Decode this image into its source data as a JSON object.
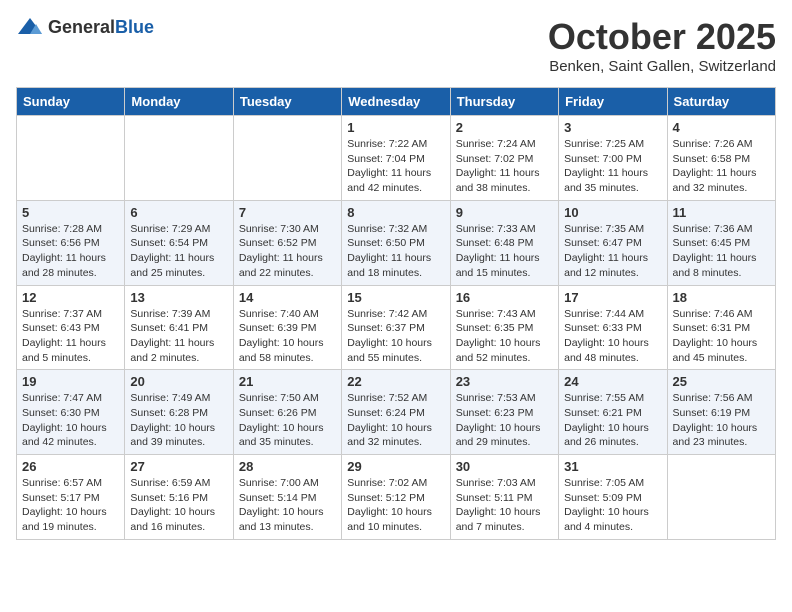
{
  "header": {
    "logo_general": "General",
    "logo_blue": "Blue",
    "month": "October 2025",
    "location": "Benken, Saint Gallen, Switzerland"
  },
  "days_of_week": [
    "Sunday",
    "Monday",
    "Tuesday",
    "Wednesday",
    "Thursday",
    "Friday",
    "Saturday"
  ],
  "weeks": [
    [
      {
        "day": "",
        "info": ""
      },
      {
        "day": "",
        "info": ""
      },
      {
        "day": "",
        "info": ""
      },
      {
        "day": "1",
        "info": "Sunrise: 7:22 AM\nSunset: 7:04 PM\nDaylight: 11 hours and 42 minutes."
      },
      {
        "day": "2",
        "info": "Sunrise: 7:24 AM\nSunset: 7:02 PM\nDaylight: 11 hours and 38 minutes."
      },
      {
        "day": "3",
        "info": "Sunrise: 7:25 AM\nSunset: 7:00 PM\nDaylight: 11 hours and 35 minutes."
      },
      {
        "day": "4",
        "info": "Sunrise: 7:26 AM\nSunset: 6:58 PM\nDaylight: 11 hours and 32 minutes."
      }
    ],
    [
      {
        "day": "5",
        "info": "Sunrise: 7:28 AM\nSunset: 6:56 PM\nDaylight: 11 hours and 28 minutes."
      },
      {
        "day": "6",
        "info": "Sunrise: 7:29 AM\nSunset: 6:54 PM\nDaylight: 11 hours and 25 minutes."
      },
      {
        "day": "7",
        "info": "Sunrise: 7:30 AM\nSunset: 6:52 PM\nDaylight: 11 hours and 22 minutes."
      },
      {
        "day": "8",
        "info": "Sunrise: 7:32 AM\nSunset: 6:50 PM\nDaylight: 11 hours and 18 minutes."
      },
      {
        "day": "9",
        "info": "Sunrise: 7:33 AM\nSunset: 6:48 PM\nDaylight: 11 hours and 15 minutes."
      },
      {
        "day": "10",
        "info": "Sunrise: 7:35 AM\nSunset: 6:47 PM\nDaylight: 11 hours and 12 minutes."
      },
      {
        "day": "11",
        "info": "Sunrise: 7:36 AM\nSunset: 6:45 PM\nDaylight: 11 hours and 8 minutes."
      }
    ],
    [
      {
        "day": "12",
        "info": "Sunrise: 7:37 AM\nSunset: 6:43 PM\nDaylight: 11 hours and 5 minutes."
      },
      {
        "day": "13",
        "info": "Sunrise: 7:39 AM\nSunset: 6:41 PM\nDaylight: 11 hours and 2 minutes."
      },
      {
        "day": "14",
        "info": "Sunrise: 7:40 AM\nSunset: 6:39 PM\nDaylight: 10 hours and 58 minutes."
      },
      {
        "day": "15",
        "info": "Sunrise: 7:42 AM\nSunset: 6:37 PM\nDaylight: 10 hours and 55 minutes."
      },
      {
        "day": "16",
        "info": "Sunrise: 7:43 AM\nSunset: 6:35 PM\nDaylight: 10 hours and 52 minutes."
      },
      {
        "day": "17",
        "info": "Sunrise: 7:44 AM\nSunset: 6:33 PM\nDaylight: 10 hours and 48 minutes."
      },
      {
        "day": "18",
        "info": "Sunrise: 7:46 AM\nSunset: 6:31 PM\nDaylight: 10 hours and 45 minutes."
      }
    ],
    [
      {
        "day": "19",
        "info": "Sunrise: 7:47 AM\nSunset: 6:30 PM\nDaylight: 10 hours and 42 minutes."
      },
      {
        "day": "20",
        "info": "Sunrise: 7:49 AM\nSunset: 6:28 PM\nDaylight: 10 hours and 39 minutes."
      },
      {
        "day": "21",
        "info": "Sunrise: 7:50 AM\nSunset: 6:26 PM\nDaylight: 10 hours and 35 minutes."
      },
      {
        "day": "22",
        "info": "Sunrise: 7:52 AM\nSunset: 6:24 PM\nDaylight: 10 hours and 32 minutes."
      },
      {
        "day": "23",
        "info": "Sunrise: 7:53 AM\nSunset: 6:23 PM\nDaylight: 10 hours and 29 minutes."
      },
      {
        "day": "24",
        "info": "Sunrise: 7:55 AM\nSunset: 6:21 PM\nDaylight: 10 hours and 26 minutes."
      },
      {
        "day": "25",
        "info": "Sunrise: 7:56 AM\nSunset: 6:19 PM\nDaylight: 10 hours and 23 minutes."
      }
    ],
    [
      {
        "day": "26",
        "info": "Sunrise: 6:57 AM\nSunset: 5:17 PM\nDaylight: 10 hours and 19 minutes."
      },
      {
        "day": "27",
        "info": "Sunrise: 6:59 AM\nSunset: 5:16 PM\nDaylight: 10 hours and 16 minutes."
      },
      {
        "day": "28",
        "info": "Sunrise: 7:00 AM\nSunset: 5:14 PM\nDaylight: 10 hours and 13 minutes."
      },
      {
        "day": "29",
        "info": "Sunrise: 7:02 AM\nSunset: 5:12 PM\nDaylight: 10 hours and 10 minutes."
      },
      {
        "day": "30",
        "info": "Sunrise: 7:03 AM\nSunset: 5:11 PM\nDaylight: 10 hours and 7 minutes."
      },
      {
        "day": "31",
        "info": "Sunrise: 7:05 AM\nSunset: 5:09 PM\nDaylight: 10 hours and 4 minutes."
      },
      {
        "day": "",
        "info": ""
      }
    ]
  ]
}
